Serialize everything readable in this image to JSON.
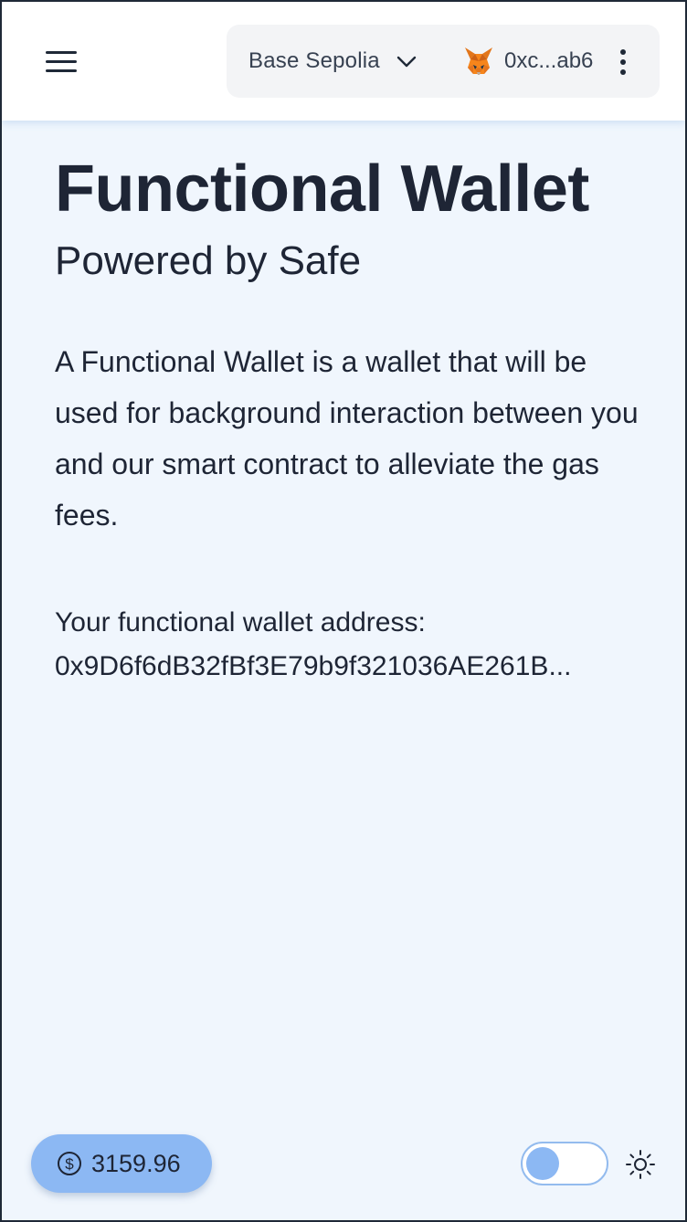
{
  "header": {
    "network": {
      "label": "Base Sepolia",
      "icon": "chevron-down-icon"
    },
    "account": {
      "label": "0xc...ab6",
      "icon": "metamask-fox-icon"
    },
    "menu_icon": "hamburger-menu-icon",
    "more_icon": "kebab-menu-icon"
  },
  "main": {
    "title": "Functional Wallet",
    "subtitle": "Powered by Safe",
    "description": "A Functional Wallet is a wallet that will be used for background interaction between you and our smart contract to alleviate the gas fees.",
    "address_label": "Your functional wallet address:",
    "address_value": "0x9D6f6dB32fBf3E79b9f321036AE261B..."
  },
  "footer": {
    "price": {
      "value": "3159.96",
      "icon": "dollar-circle-icon"
    },
    "theme_toggle": {
      "state": "off",
      "icon": "sun-icon"
    }
  },
  "colors": {
    "background": "#f0f6fd",
    "header_bg": "#ffffff",
    "pill_bg": "#f3f4f6",
    "accent": "#8cb8f3",
    "text": "#1e2535"
  }
}
